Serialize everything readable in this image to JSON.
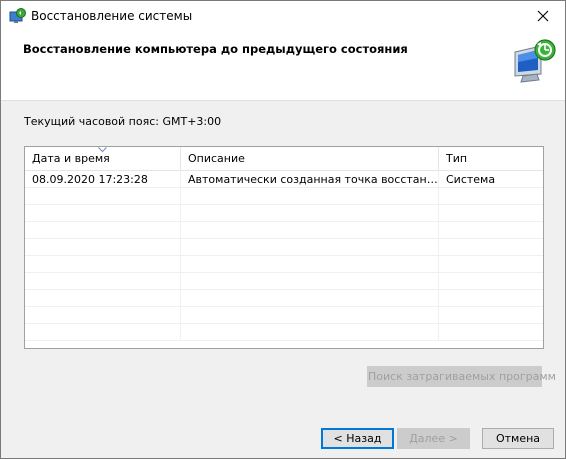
{
  "window": {
    "title": "Восстановление системы"
  },
  "header": {
    "title": "Восстановление компьютера до предыдущего состояния"
  },
  "timezone_label": "Текущий часовой пояс: GMT+3:00",
  "restore_points": {
    "columns": [
      "Дата и время",
      "Описание",
      "Тип"
    ],
    "rows": [
      {
        "datetime": "08.09.2020 17:23:28",
        "description": "Автоматически созданная точка восстановле...",
        "type": "Система"
      }
    ]
  },
  "buttons": {
    "scan_affected": "Поиск затрагиваемых программ",
    "back": "< Назад",
    "next": "Далее >",
    "cancel": "Отмена"
  },
  "icons": {
    "title": "system-restore-icon",
    "header": "system-restore-monitor-icon",
    "close": "close-icon",
    "sort": "sort-descending-icon"
  },
  "colors": {
    "default_button_border": "#0078d7",
    "disabled_text": "#a0a0a0",
    "window_bg": "#f0f0f0"
  }
}
